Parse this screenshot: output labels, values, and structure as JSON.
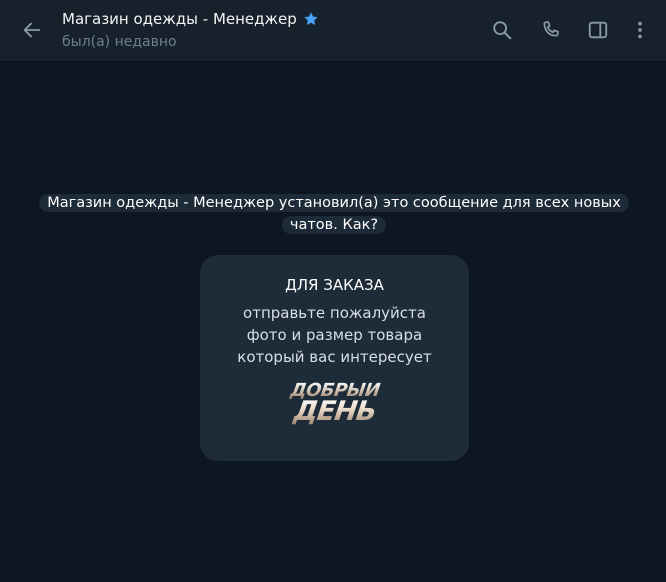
{
  "header": {
    "title": "Магазин одежды - Менеджер",
    "status": "был(а) недавно",
    "icons": {
      "back": "arrow-left-icon",
      "verified": "star-icon",
      "search": "search-icon",
      "call": "phone-icon",
      "sidepanel": "sidebar-toggle-icon",
      "more": "more-vertical-icon"
    }
  },
  "service_message": {
    "text": "Магазин одежды - Менеджер установил(а) это сообщение для всех новых чатов. Как?"
  },
  "card": {
    "heading": "ДЛЯ ЗАКАЗА",
    "lines": [
      "отправьте пожалуйста",
      "фото и размер товара",
      "который вас интересует"
    ],
    "sticker": {
      "line1": "ДОБРЫЙ",
      "line2": "ДЕНЬ"
    }
  },
  "colors": {
    "background": "#0e1621",
    "header": "#17212b",
    "bubble": "#1e2c3a",
    "accent_star": "#4ea4f6",
    "icon": "#8a9aa9"
  }
}
